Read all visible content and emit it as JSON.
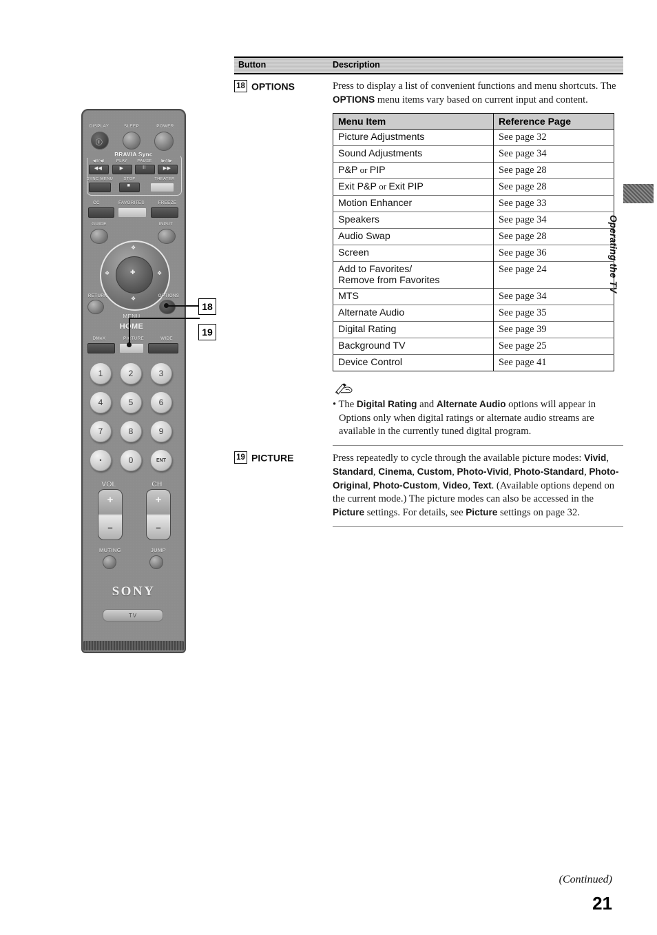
{
  "page": {
    "number": "21",
    "continued_label": "(Continued)",
    "side_tab_label": "Operating the TV"
  },
  "table": {
    "header": {
      "button": "Button",
      "description": "Description"
    },
    "rows": [
      {
        "num": "18",
        "name": "OPTIONS",
        "intro_parts": [
          {
            "t": "Press to display a list of convenient functions and menu shortcuts. The ",
            "b": false
          },
          {
            "t": "OPTIONS",
            "b": true
          },
          {
            "t": " menu items vary based on current input and content.",
            "b": false
          }
        ]
      },
      {
        "num": "19",
        "name": "PICTURE",
        "desc_parts": [
          {
            "t": "Press repeatedly to cycle through the available picture modes: ",
            "b": false
          },
          {
            "t": "Vivid",
            "b": true
          },
          {
            "t": ", ",
            "b": false
          },
          {
            "t": "Standard",
            "b": true
          },
          {
            "t": ", ",
            "b": false
          },
          {
            "t": "Cinema",
            "b": true
          },
          {
            "t": ", ",
            "b": false
          },
          {
            "t": "Custom",
            "b": true
          },
          {
            "t": ", ",
            "b": false
          },
          {
            "t": "Photo-Vivid",
            "b": true
          },
          {
            "t": ", ",
            "b": false
          },
          {
            "t": "Photo-Standard",
            "b": true
          },
          {
            "t": ", ",
            "b": false
          },
          {
            "t": "Photo-Original",
            "b": true
          },
          {
            "t": ", ",
            "b": false
          },
          {
            "t": "Photo-Custom",
            "b": true
          },
          {
            "t": ", ",
            "b": false
          },
          {
            "t": "Video",
            "b": true
          },
          {
            "t": ", ",
            "b": false
          },
          {
            "t": "Text",
            "b": true
          },
          {
            "t": ". (Available options depend on the current mode.) The picture modes can also be accessed in the ",
            "b": false
          },
          {
            "t": "Picture",
            "b": true
          },
          {
            "t": " settings. For details, see ",
            "b": false
          },
          {
            "t": "Picture",
            "b": true
          },
          {
            "t": " settings on page 32.",
            "b": false
          }
        ]
      }
    ]
  },
  "menu_table": {
    "headers": {
      "item": "Menu Item",
      "reference": "Reference Page"
    },
    "rows": [
      {
        "item": "Picture Adjustments",
        "ref": "See page 32"
      },
      {
        "item": "Sound Adjustments",
        "ref": "See page 34"
      },
      {
        "item": "P&P or PIP",
        "ref": "See page 28",
        "mixed": [
          {
            "t": "P&P",
            "s": false
          },
          {
            "t": " or ",
            "s": true
          },
          {
            "t": "PIP",
            "s": false
          }
        ]
      },
      {
        "item": "Exit P&P or Exit PIP",
        "ref": "See page 28",
        "mixed": [
          {
            "t": "Exit P&P",
            "s": false
          },
          {
            "t": " or ",
            "s": true
          },
          {
            "t": "Exit PIP",
            "s": false
          }
        ]
      },
      {
        "item": "Motion Enhancer",
        "ref": "See page 33"
      },
      {
        "item": "Speakers",
        "ref": "See page 34"
      },
      {
        "item": "Audio Swap",
        "ref": "See page 28"
      },
      {
        "item": "Screen",
        "ref": "See page 36"
      },
      {
        "item": "Add to Favorites/\nRemove from Favorites",
        "ref": "See page 24"
      },
      {
        "item": "MTS",
        "ref": "See page 34"
      },
      {
        "item": "Alternate Audio",
        "ref": "See page 35"
      },
      {
        "item": "Digital Rating",
        "ref": "See page 39"
      },
      {
        "item": "Background TV",
        "ref": "See page 25"
      },
      {
        "item": "Device Control",
        "ref": "See page 41"
      }
    ]
  },
  "note": {
    "icon_name": "pencil-note-icon",
    "parts": [
      {
        "t": "The ",
        "b": false
      },
      {
        "t": "Digital Rating",
        "b": true
      },
      {
        "t": " and ",
        "b": false
      },
      {
        "t": "Alternate Audio",
        "b": true
      },
      {
        "t": " options will appear in Options only when digital ratings or alternate audio streams are available in the currently tuned digital program.",
        "b": false
      }
    ]
  },
  "callouts": [
    {
      "id": "18"
    },
    {
      "id": "19"
    }
  ],
  "remote": {
    "brand": "SONY",
    "tv_button": "TV",
    "top_buttons": [
      "DISPLAY",
      "SLEEP",
      "POWER"
    ],
    "bravia_title": "BRAVIA Sync",
    "bravia_row1": [
      "◀II/◀I",
      "PLAY",
      "PAUSE",
      "I▶/II▶"
    ],
    "bravia_row2": [
      "SYNC MENU",
      "STOP",
      "THEATER"
    ],
    "func_row": [
      "CC",
      "FAVORITES",
      "FREEZE"
    ],
    "guide": "GUIDE",
    "input": "INPUT",
    "return": "RETURN",
    "options": "OPTIONS",
    "menu": "MENU",
    "home": "HOME",
    "mode_row": [
      "DMeX",
      "PICTURE",
      "WIDE"
    ],
    "keypad": [
      "1",
      "2",
      "3",
      "4",
      "5",
      "6",
      "7",
      "8",
      "9",
      "•",
      "0",
      "ENT"
    ],
    "vol_label": "VOL",
    "ch_label": "CH",
    "muting": "MUTING",
    "jump": "JUMP"
  }
}
